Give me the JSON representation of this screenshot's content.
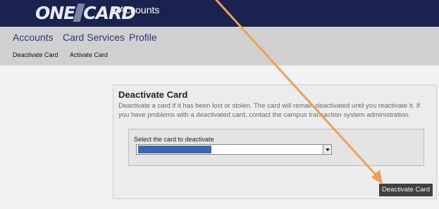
{
  "header": {
    "logo_text_left": "ONE",
    "logo_text_right": "CARD",
    "app_title": "eAccounts"
  },
  "nav": {
    "items": [
      "Accounts",
      "Card Services",
      "Profile"
    ]
  },
  "subnav": {
    "items": [
      "Deactivate Card",
      "Activate Card"
    ]
  },
  "panel": {
    "title": "Deactivate Card",
    "description": "Deactivate a card if it has been lost or stolen. The card will remain deactivated until you reactivate it. If you have problems with a deactivated card, contact the campus transaction system administration.",
    "select_label": "Select the card to deactivate",
    "button_label": "Deactivate Card"
  },
  "colors": {
    "header_bg": "#1a2350",
    "nav_bg": "#d0d0d0",
    "nav_link": "#2a3a7a",
    "annotation_arrow": "#f0a050",
    "button_bg": "#404040"
  }
}
